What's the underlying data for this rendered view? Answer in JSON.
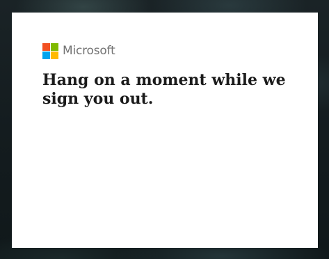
{
  "brand": {
    "name": "Microsoft",
    "logo_colors": {
      "red": "#f25022",
      "green": "#7fba00",
      "blue": "#00a4ef",
      "yellow": "#ffb900"
    }
  },
  "dialog": {
    "title": "Hang on a moment while we sign you out."
  }
}
